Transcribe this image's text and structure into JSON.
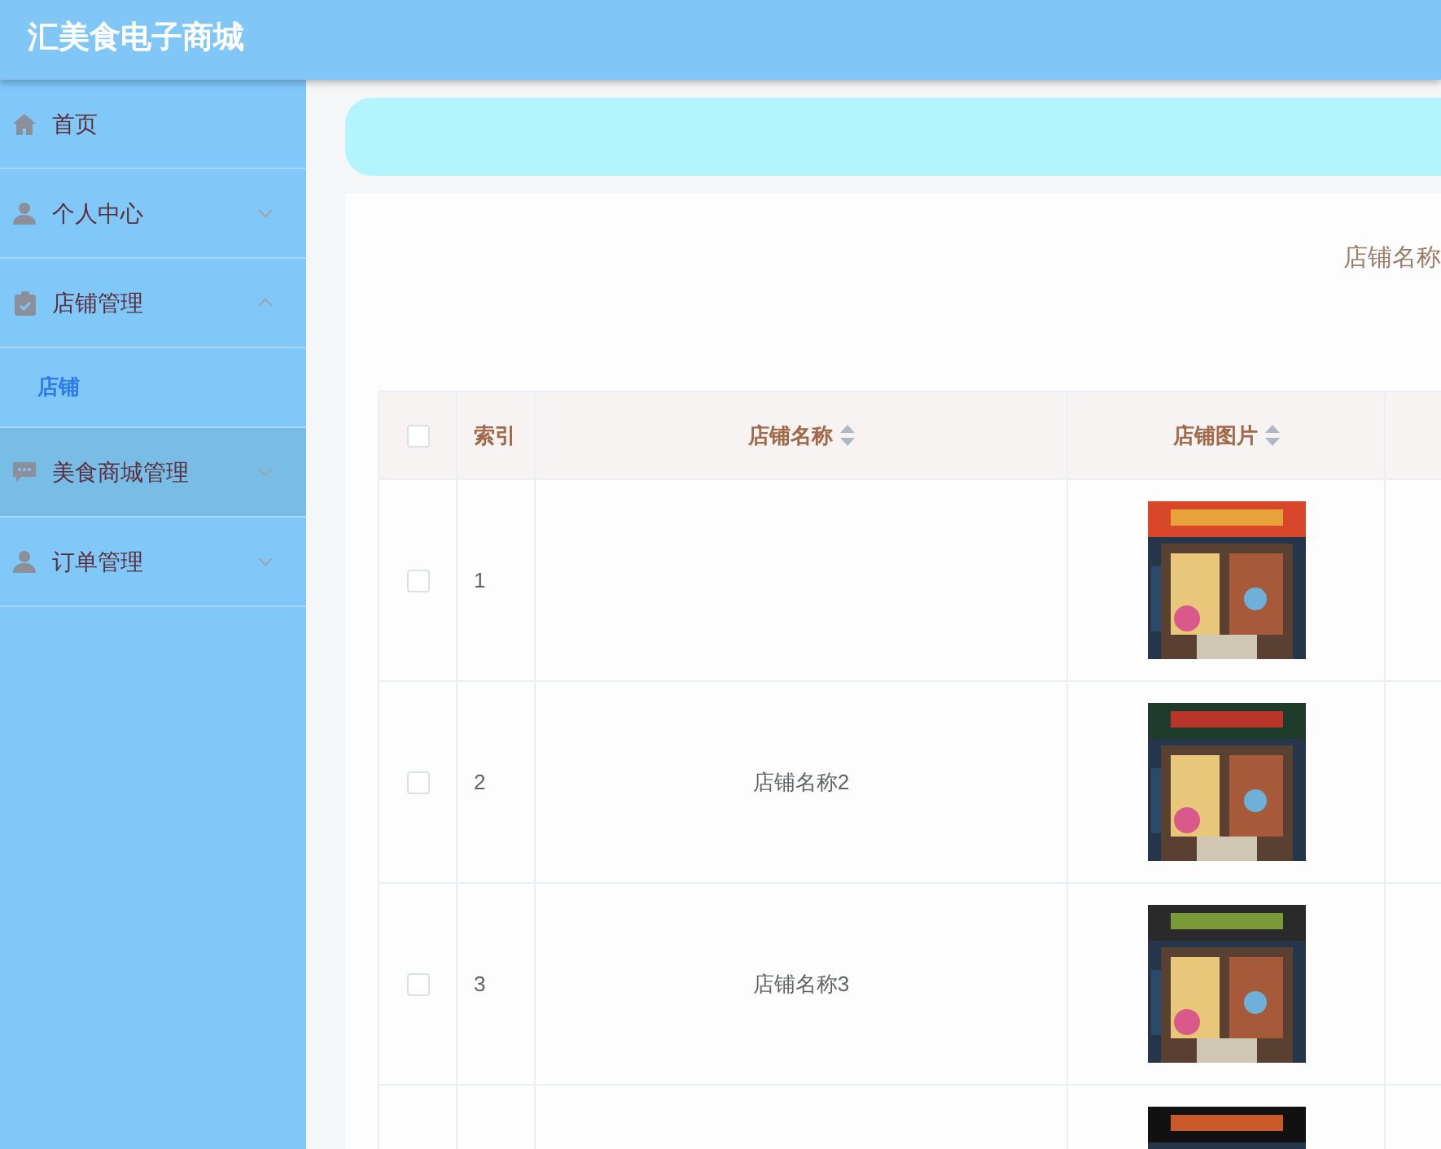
{
  "header": {
    "title": "汇美食电子商城"
  },
  "sidebar": {
    "items": [
      {
        "label": "首页",
        "hovered": false
      },
      {
        "label": "个人中心",
        "expanded": false,
        "hovered": false
      },
      {
        "label": "店铺管理",
        "expanded": true,
        "hovered": false,
        "children": [
          {
            "label": "店铺",
            "selected": true
          }
        ]
      },
      {
        "label": "美食商城管理",
        "expanded": false,
        "hovered": true
      },
      {
        "label": "订单管理",
        "expanded": false,
        "hovered": false
      }
    ]
  },
  "search": {
    "label": "店铺名称"
  },
  "table": {
    "select_all": {
      "checked": false
    },
    "columns": [
      {
        "label": "索引",
        "sortable": false
      },
      {
        "label": "店铺名称",
        "sortable": true
      },
      {
        "label": "店铺图片",
        "sortable": true
      }
    ],
    "rows": [
      {
        "checked": false,
        "index": "1",
        "image": {
          "kind": "picture"
        }
      },
      {
        "checked": false,
        "index": "2",
        "name": "店铺名称2",
        "image": {
          "kind": "picture"
        }
      },
      {
        "checked": false,
        "index": "3",
        "name": "店铺名称3",
        "image": {
          "kind": "picture"
        }
      },
      {
        "image": {
          "kind": "picture"
        }
      }
    ]
  }
}
